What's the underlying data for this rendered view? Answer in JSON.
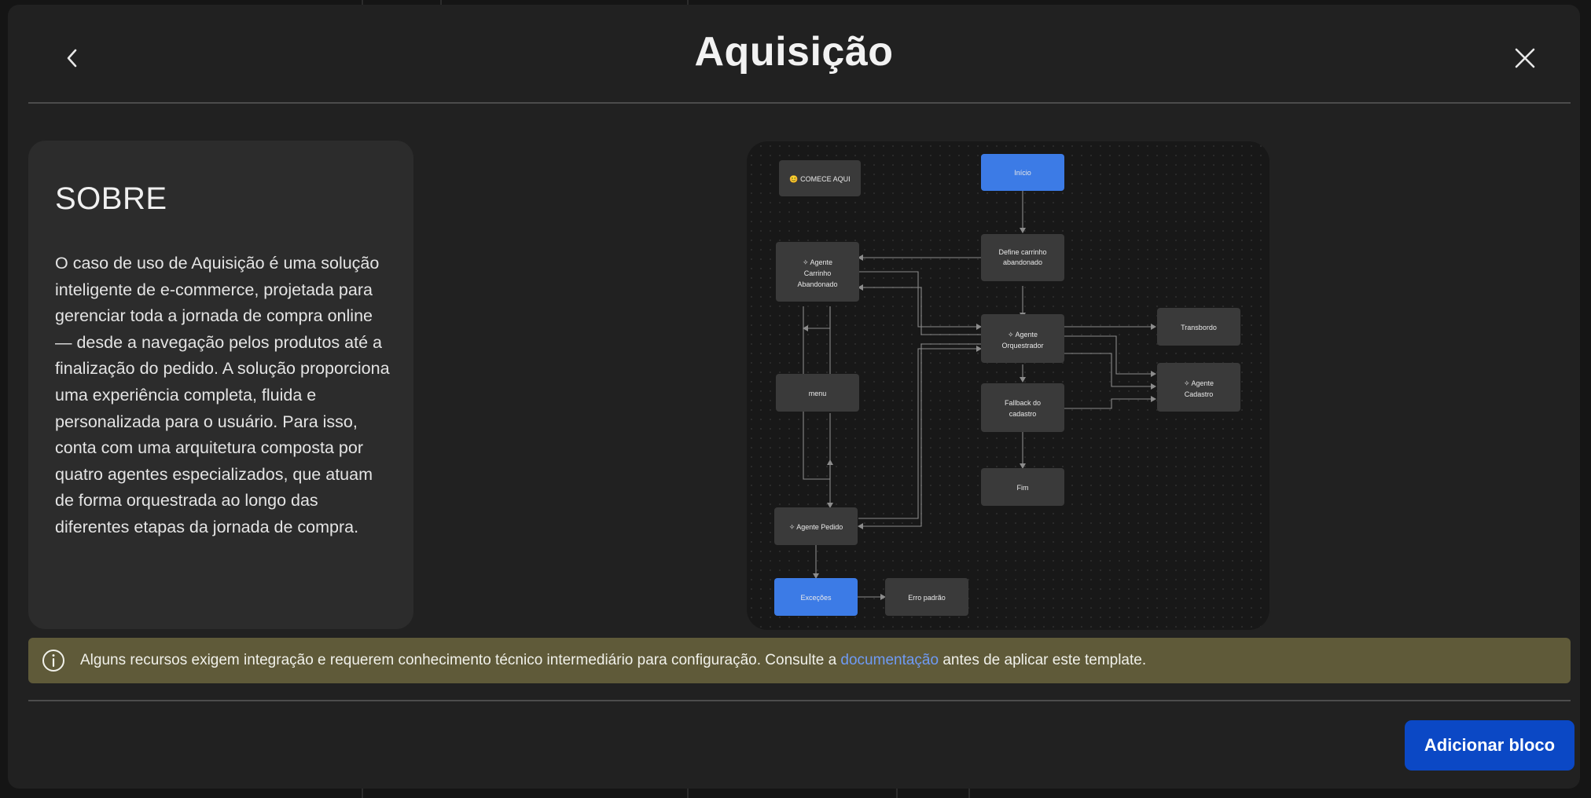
{
  "modal": {
    "title": "Aquisição",
    "back_icon": "chevron-left-icon",
    "close_icon": "close-icon"
  },
  "about": {
    "heading": "SOBRE",
    "description": "O caso de uso de Aquisição é uma solução inteligente de e-commerce, projetada para gerenciar toda a jornada de compra online — desde a navegação pelos produtos até a finalização do pedido. A solução proporciona uma experiência completa, fluida e personalizada para o usuário. Para isso, conta com uma arquitetura composta por quatro agentes especializados, que atuam de forma orquestrada ao longo das diferentes etapas da jornada de compra."
  },
  "flow": {
    "nodes": {
      "comece": "😊 COMECE AQUI",
      "inicio": "Início",
      "define": [
        "Define carrinho",
        "abandonado"
      ],
      "agente_carrinho": [
        "Agente",
        "Carrinho",
        "Abandonado"
      ],
      "orquestrador": [
        "Agente",
        "Orquestrador"
      ],
      "transbordo": "Transbordo",
      "cadastro": [
        "Agente",
        "Cadastro"
      ],
      "menu": "menu",
      "fallback": [
        "Fallback do",
        "cadastro"
      ],
      "fim": "Fim",
      "pedido": "Agente Pedido",
      "excecoes": "Exceções",
      "erro": "Erro padrão"
    },
    "colors": {
      "primary": "#3c7be6",
      "node": "#3a3a3a",
      "edge": "#8a8a8a"
    }
  },
  "notice": {
    "icon": "info-circle-icon",
    "text_before": "Alguns recursos exigem integração e requerem conhecimento técnico intermediário para configuração. Consulte a ",
    "link": "documentação",
    "text_after": " antes de aplicar este template."
  },
  "footer": {
    "add_button": "Adicionar bloco"
  },
  "colors": {
    "accent": "#0b48c5",
    "notice_bg": "#5f5a39",
    "link": "#6f9bf5"
  }
}
